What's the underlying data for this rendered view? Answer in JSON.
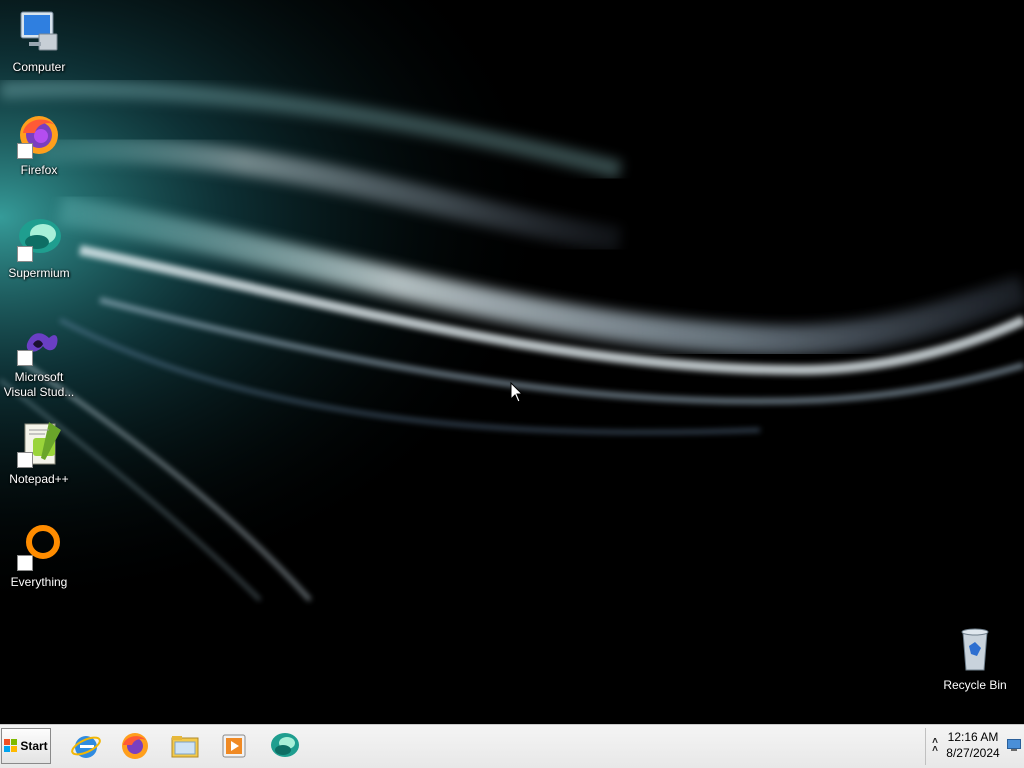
{
  "desktop": {
    "icons": [
      {
        "label": "Computer",
        "icon": "computer-icon"
      },
      {
        "label": "Firefox",
        "icon": "firefox-icon"
      },
      {
        "label": "Supermium",
        "icon": "supermium-icon"
      },
      {
        "label": "Microsoft Visual Stud...",
        "icon": "visual-studio-icon"
      },
      {
        "label": "Notepad++",
        "icon": "notepad-plus-plus-icon"
      },
      {
        "label": "Everything",
        "icon": "everything-icon"
      },
      {
        "label": "Recycle Bin",
        "icon": "recycle-bin-icon"
      }
    ]
  },
  "taskbar": {
    "start_label": "Start",
    "pinned": [
      {
        "icon": "internet-explorer-icon"
      },
      {
        "icon": "firefox-icon"
      },
      {
        "icon": "file-explorer-icon"
      },
      {
        "icon": "media-player-icon"
      },
      {
        "icon": "supermium-icon"
      }
    ],
    "tray": {
      "time": "12:16 AM",
      "date": "8/27/2024"
    }
  },
  "colors": {
    "desktop_background": "#000000",
    "taskbar": "#eeeeee",
    "wallpaper_streak": "#cfe6ee",
    "wallpaper_glow": "#2a8a8f"
  }
}
